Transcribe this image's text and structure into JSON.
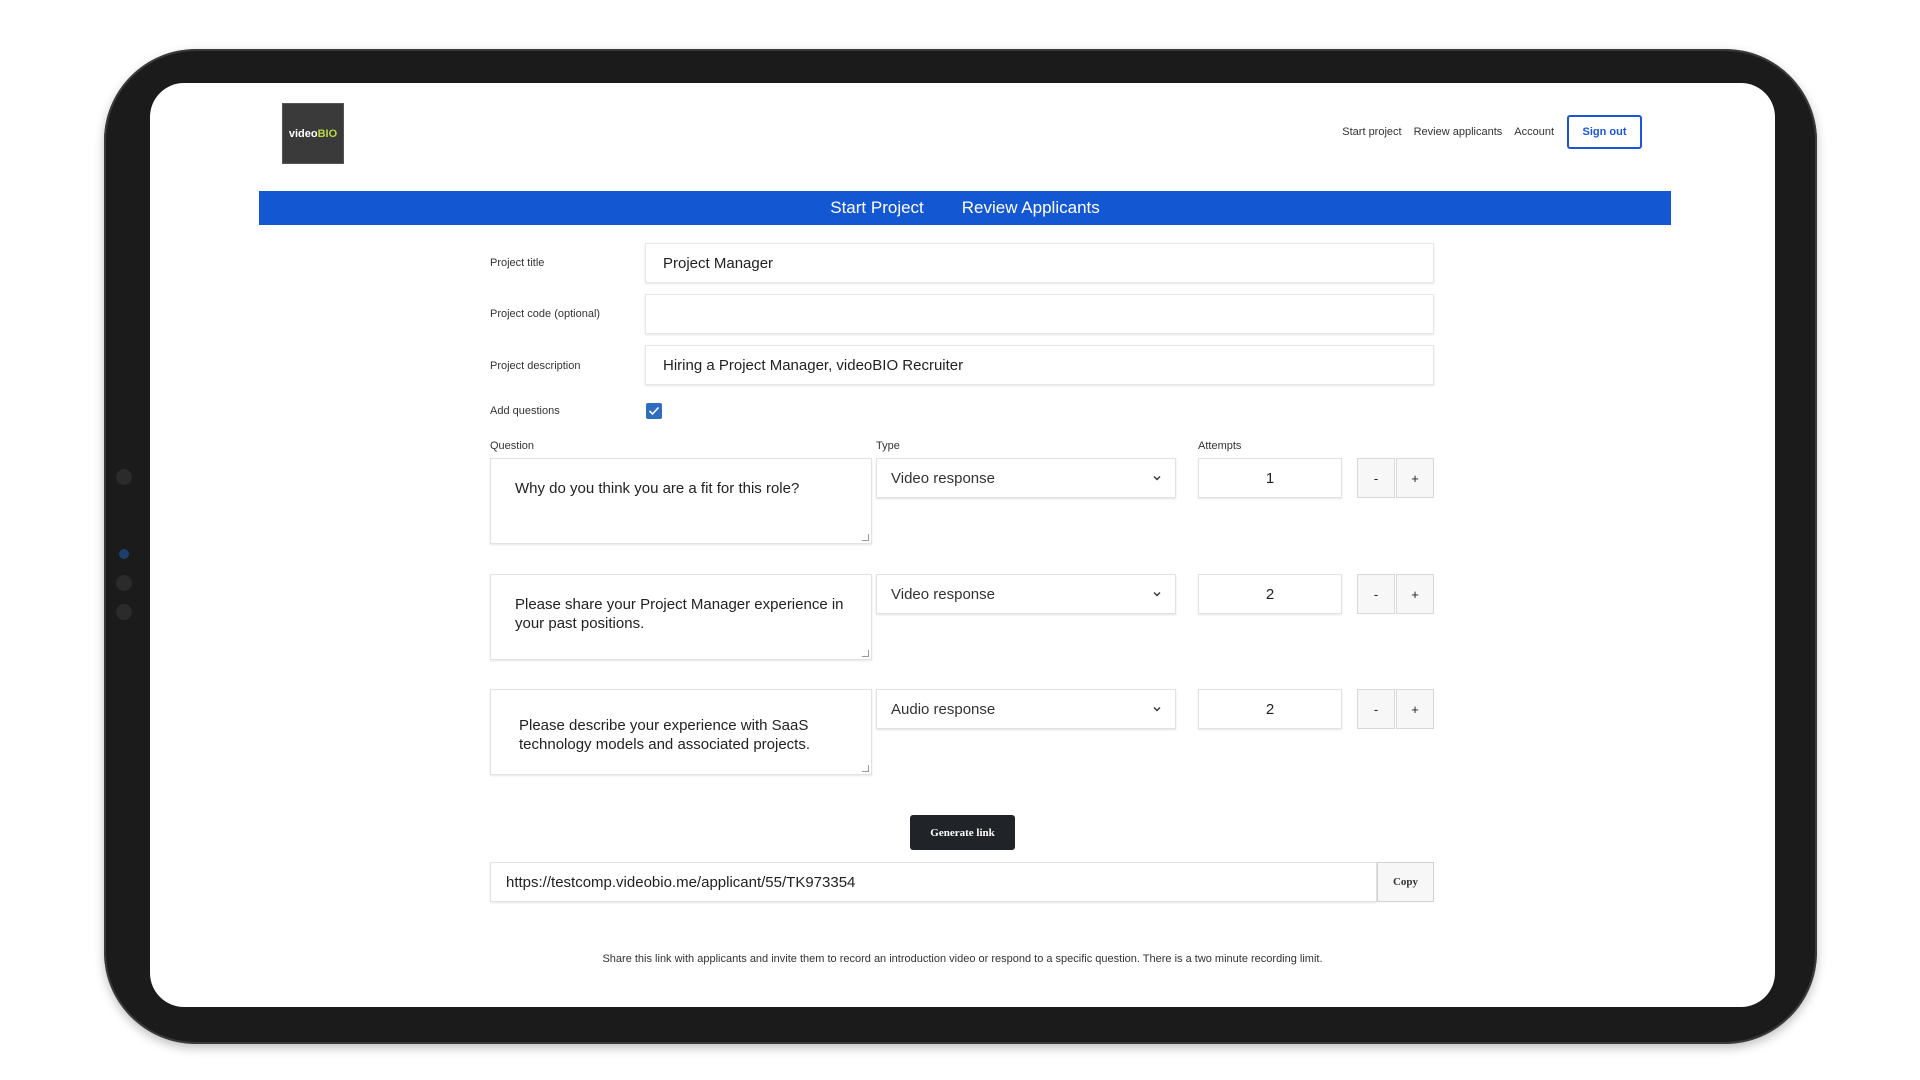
{
  "logo": {
    "text_main": "video",
    "text_accent": "BIO"
  },
  "topnav": {
    "links": [
      "Start project",
      "Review applicants",
      "Account"
    ],
    "signout_label": "Sign out"
  },
  "tabs": [
    "Start Project",
    "Review Applicants"
  ],
  "form": {
    "project_title": {
      "label": "Project title",
      "value": "Project Manager"
    },
    "project_code": {
      "label": "Project code (optional)",
      "value": ""
    },
    "project_description": {
      "label": "Project description",
      "value": "Hiring a Project Manager, videoBIO Recruiter"
    },
    "add_questions": {
      "label": "Add questions",
      "checked": true
    }
  },
  "questions_header": {
    "question": "Question",
    "type": "Type",
    "attempts": "Attempts"
  },
  "questions": [
    {
      "question": "Why do you think you are a fit for this role?",
      "type": "Video response",
      "attempts": "1"
    },
    {
      "question": "Please share your Project Manager experience in your past positions.",
      "type": "Video response",
      "attempts": "2"
    },
    {
      "question": "Please describe your experience with SaaS technology models and associated projects.",
      "type": "Audio response",
      "attempts": "2"
    }
  ],
  "stepper": {
    "minus": "-",
    "plus": "+"
  },
  "generate_label": "Generate link",
  "link": {
    "value": "https://testcomp.videobio.me/applicant/55/TK973354",
    "copy_label": "Copy"
  },
  "footer_note": "Share this link with applicants and invite them to record an introduction video or respond to a specific question. There is a two minute recording limit.",
  "colors": {
    "accent": "#1457d2",
    "dark_button": "#202327",
    "checkbox": "#2f6dc0",
    "logo_accent": "#b9d84a"
  }
}
